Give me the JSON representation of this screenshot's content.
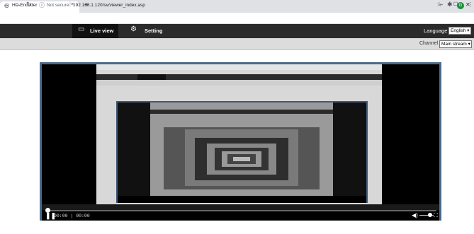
{
  "browser": {
    "tab_title": "HD Encoder",
    "tab_icon": "globe-icon",
    "close_glyph": "×",
    "new_tab_glyph": "+",
    "security_label": "Not secure",
    "url": "192.168.1.120/sv/viewer_index.asp",
    "profile_initial": "G"
  },
  "app": {
    "live_view_label": "Live view",
    "setting_label": "Setting",
    "language_label": "Language :",
    "language_value": "English",
    "channel_label": "Channel :",
    "channel_value": "Main stream"
  },
  "player": {
    "time": "00:00 | 00:00",
    "progress": 0
  },
  "colors": {
    "header_bg": "#2b2b2b",
    "active_tab_bg": "#111111",
    "channel_bar_bg": "#dcdcdc",
    "player_border": "#4a6a8a"
  }
}
